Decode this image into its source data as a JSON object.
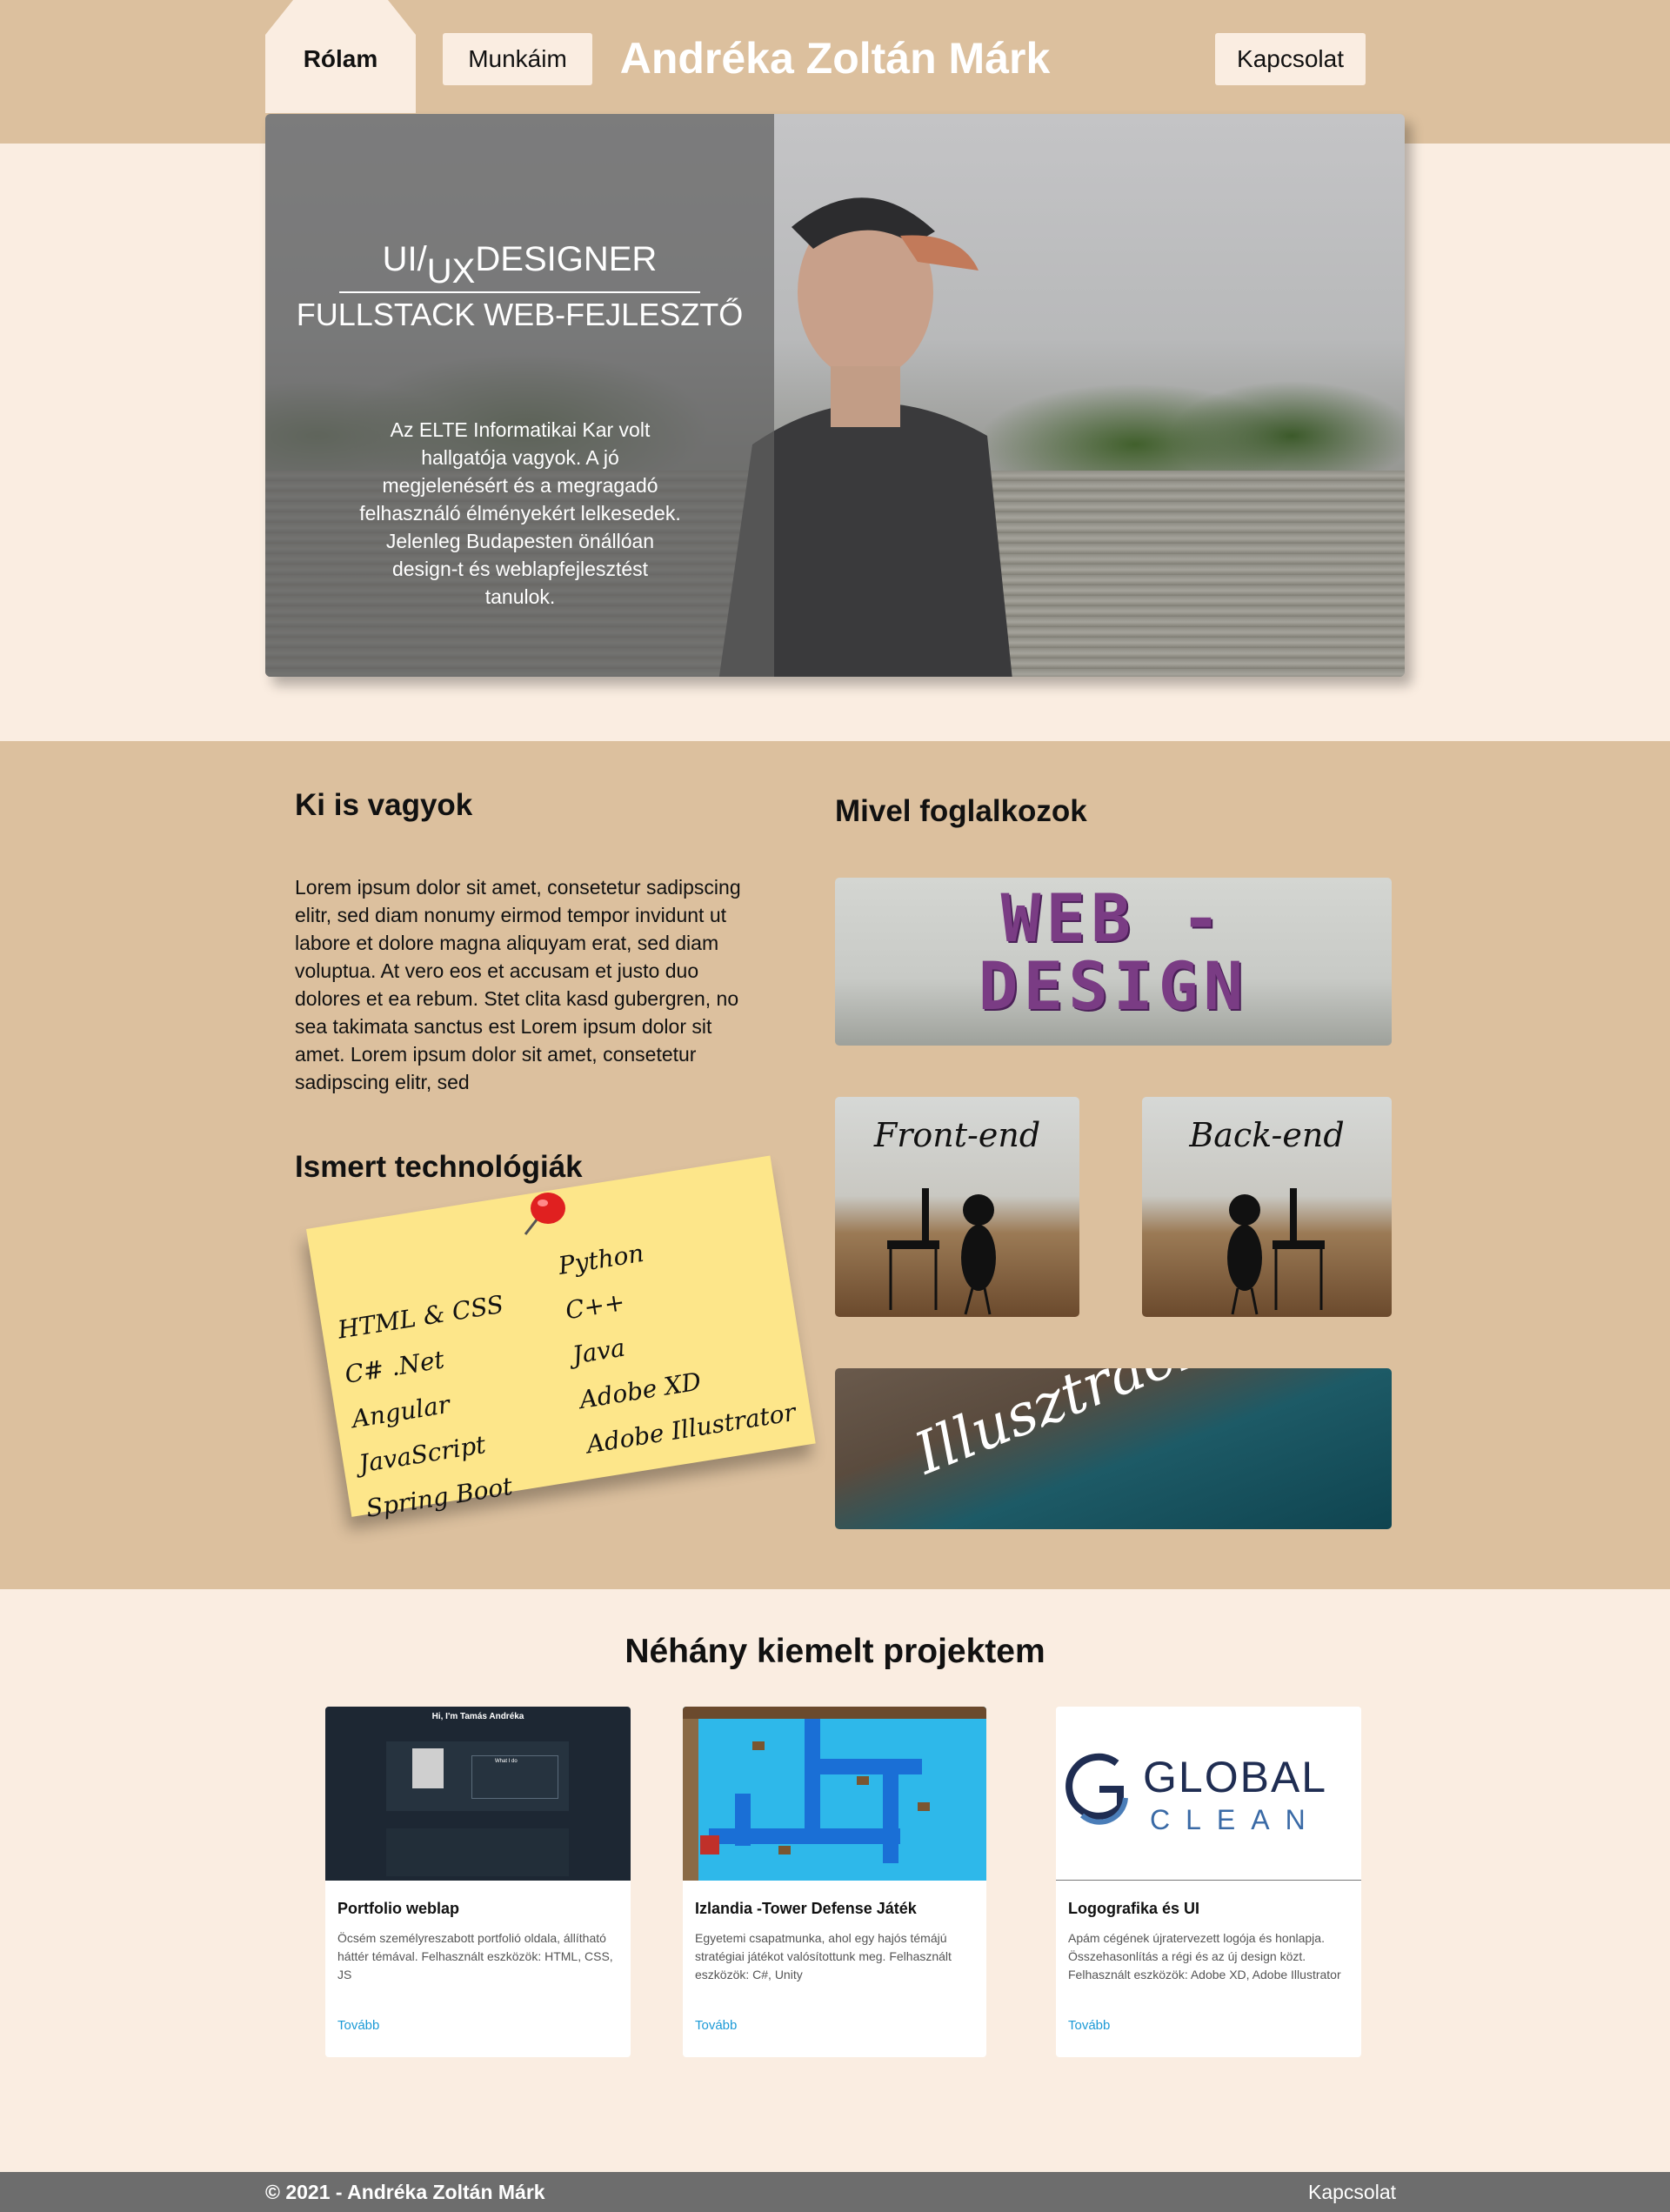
{
  "nav": {
    "about_tab": "Rólam",
    "works_button": "Munkáim",
    "contact_button": "Kapcsolat",
    "site_title": "Andréka Zoltán Márk"
  },
  "hero": {
    "role_ui": "UI/",
    "role_ux": "UX",
    "role_designer": "DESIGNER",
    "role_fullstack": "FULLSTACK WEB-FEJLESZTŐ",
    "description": "Az ELTE Informatikai Kar volt hallgatója vagyok. A jó megjelenésért és a megragadó felhasználó élményekért lelkesedek. Jelenleg Budapesten önállóan design-t és weblapfejlesztést tanulok."
  },
  "about": {
    "who_heading": "Ki is vagyok",
    "who_text": "Lorem ipsum dolor sit amet, consetetur sadipscing elitr, sed diam nonumy eirmod tempor invidunt ut labore et dolore magna aliquyam erat, sed diam voluptua. At vero eos et accusam et justo duo dolores et ea rebum. Stet clita kasd gubergren, no sea takimata sanctus est Lorem ipsum dolor sit amet. Lorem ipsum dolor sit amet, consetetur sadipscing elitr, sed",
    "tech_heading": "Ismert technológiák",
    "tech_left": [
      "HTML & CSS",
      "C# .Net",
      "Angular",
      "JavaScript",
      "Spring Boot"
    ],
    "tech_right": [
      "Python",
      "C++",
      "Java",
      "Adobe XD",
      "Adobe Illustrator"
    ],
    "work_heading": "Mivel foglalkozok",
    "webdesign_line1": "WEB -",
    "webdesign_line2": "DESIGN",
    "frontend_label": "Front-end",
    "backend_label": "Back-end",
    "illustration_label": "Illusztráció"
  },
  "projects": {
    "heading": "Néhány kiemelt projektem",
    "items": [
      {
        "title": "Portfolio weblap",
        "description": "Öcsém személyreszabott portfolió oldala, állítható háttér témával. Felhasznált eszközök: HTML, CSS, JS",
        "link": "Tovább",
        "thumb_title": "Hi, I'm Tamás Andréka",
        "thumb_card": "What I do"
      },
      {
        "title": "Izlandia -Tower Defense Játék",
        "description": "Egyetemi csapatmunka, ahol egy hajós témájú stratégiai játékot valósítottunk meg. Felhasznált eszközök: C#, Unity",
        "link": "Tovább"
      },
      {
        "title": "Logografika és UI",
        "description": "Apám cégének újratervezett logója és honlapja. Összehasonlítás a régi és az új design közt. Felhasznált eszközök: Adobe XD, Adobe Illustrator",
        "link": "Tovább",
        "logo_line1": "GLOBAL",
        "logo_line2": "CLEAN"
      }
    ]
  },
  "footer": {
    "copyright": "© 2021 - Andréka Zoltán Márk",
    "contact": "Kapcsolat"
  },
  "colors": {
    "header_tan": "#dcc09e",
    "page_cream": "#faede1",
    "footer_gray": "#6d6d6d",
    "link_blue": "#1c9ad6",
    "note_yellow": "#fde68a",
    "pin_red": "#e02020"
  }
}
